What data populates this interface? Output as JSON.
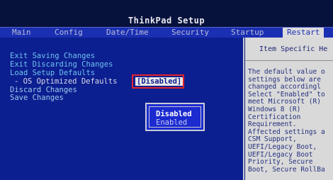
{
  "title": "ThinkPad Setup",
  "tabs": [
    {
      "label": "Main"
    },
    {
      "label": "Config"
    },
    {
      "label": "Date/Time"
    },
    {
      "label": "Security"
    },
    {
      "label": "Startup"
    },
    {
      "label": "Restart",
      "active": true
    }
  ],
  "menu": {
    "items": [
      {
        "label": "Exit Saving Changes"
      },
      {
        "label": "Exit Discarding Changes"
      },
      {
        "label": "Load Setup Defaults"
      },
      {
        "label": "- OS Optimized Defaults",
        "value": "[Disabled]"
      },
      {
        "label": "Discard Changes"
      },
      {
        "label": "Save Changes"
      }
    ]
  },
  "popup": {
    "options": [
      "Disabled",
      "Enabled"
    ],
    "selected": "Disabled"
  },
  "help": {
    "heading": "Item Specific He",
    "text": "The default value o\nsettings below are\nchanged accordingl\nSelect \"Enabled\" to\nmeet Microsoft (R)\nWindows 8 (R)\nCertification\nRequirement.\nAffected settings a\nCSM Support,\nUEFI/Legacy Boot,\nUEFI/Legacy Boot\nPriority, Secure\nBoot, Secure RollBa"
  },
  "colors": {
    "background": "#0c1e86",
    "tab_bar": "#1b2fb3",
    "menu_text": "#6ec2f0",
    "highlight_box": "#e5232c",
    "help_panel": "#d9d9d9"
  }
}
